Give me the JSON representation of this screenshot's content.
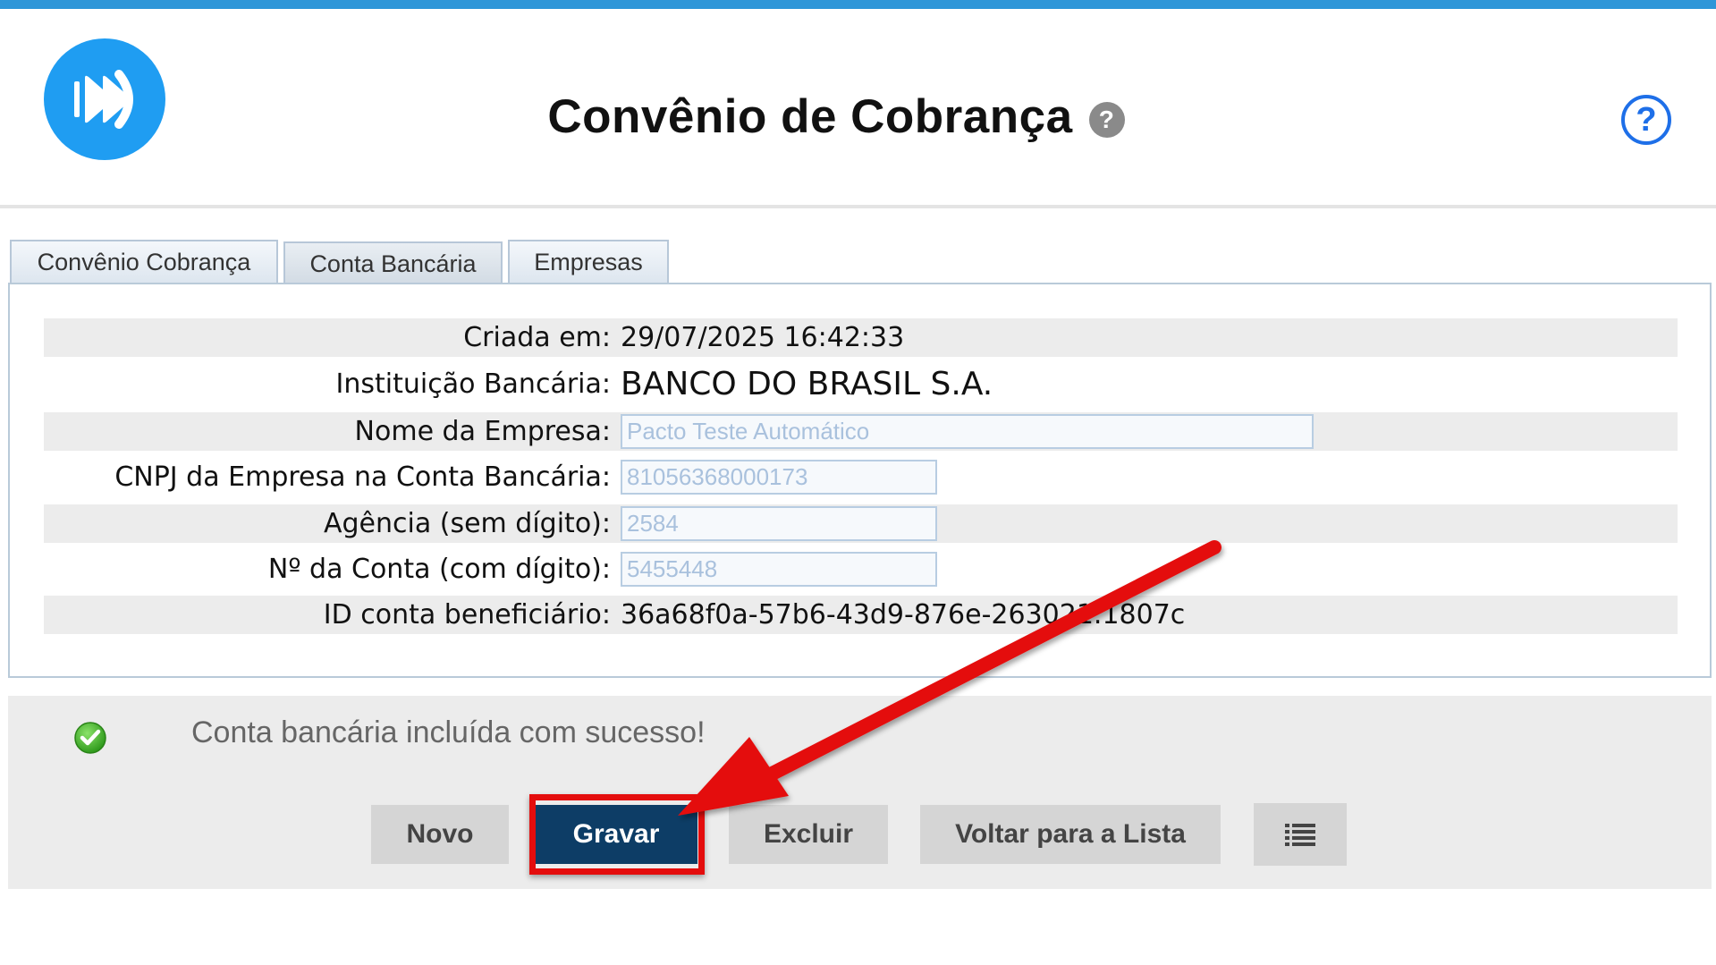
{
  "header": {
    "title": "Convênio de Cobrança",
    "title_help_glyph": "?",
    "help_glyph": "?",
    "logo_icon": "fast-forward-logo-icon",
    "accent_color": "#2e96d8"
  },
  "tabs": [
    {
      "label": "Convênio Cobrança"
    },
    {
      "label": "Conta Bancária",
      "active": true
    },
    {
      "label": "Empresas"
    }
  ],
  "form": {
    "criada_em": {
      "label": "Criada em:",
      "value": "29/07/2025 16:42:33"
    },
    "instituicao": {
      "label": "Instituição Bancária:",
      "value": "BANCO DO BRASIL S.A."
    },
    "nome_empresa": {
      "label": "Nome da Empresa:",
      "value": "Pacto Teste Automático"
    },
    "cnpj": {
      "label": "CNPJ da Empresa na Conta Bancária:",
      "value": "81056368000173"
    },
    "agencia": {
      "label": "Agência (sem dígito):",
      "value": "2584"
    },
    "conta": {
      "label": "Nº da Conta (com dígito):",
      "value": "5455448"
    },
    "id_beneficiario": {
      "label": "ID conta beneficiário:",
      "value": "36a68f0a-57b6-43d9-876e-263021.1807c"
    }
  },
  "status": {
    "message": "Conta bancária incluída com sucesso!",
    "icon": "success-check-icon"
  },
  "buttons": {
    "novo": "Novo",
    "gravar": "Gravar",
    "excluir": "Excluir",
    "voltar": "Voltar para a Lista",
    "list_icon": "list-icon"
  },
  "annotation": {
    "color": "#e40d0d",
    "target": "gravar"
  }
}
